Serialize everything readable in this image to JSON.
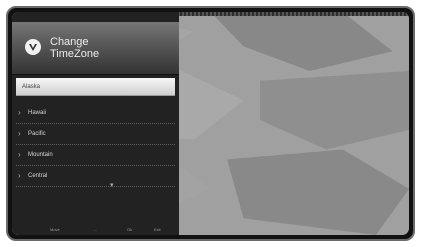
{
  "menu": {
    "title_line1": "Change",
    "title_line2": "TimeZone",
    "items": [
      {
        "label": "Alaska"
      },
      {
        "label": "Hawaii"
      },
      {
        "label": "Pacific"
      },
      {
        "label": "Mountain"
      },
      {
        "label": "Central"
      }
    ],
    "selected_index": 0
  },
  "footer": {
    "select_label": "Move",
    "back_label": "...",
    "ok_label": "Ok",
    "exit_label": "Exit"
  },
  "icons": {
    "logo": "vizio-logo-icon",
    "chevron": "chevron-right-icon",
    "more": "down-arrow-icon"
  },
  "colors": {
    "panel": "#222222",
    "header": "#5a5a5a",
    "selected_row": "#e6e6e6"
  }
}
